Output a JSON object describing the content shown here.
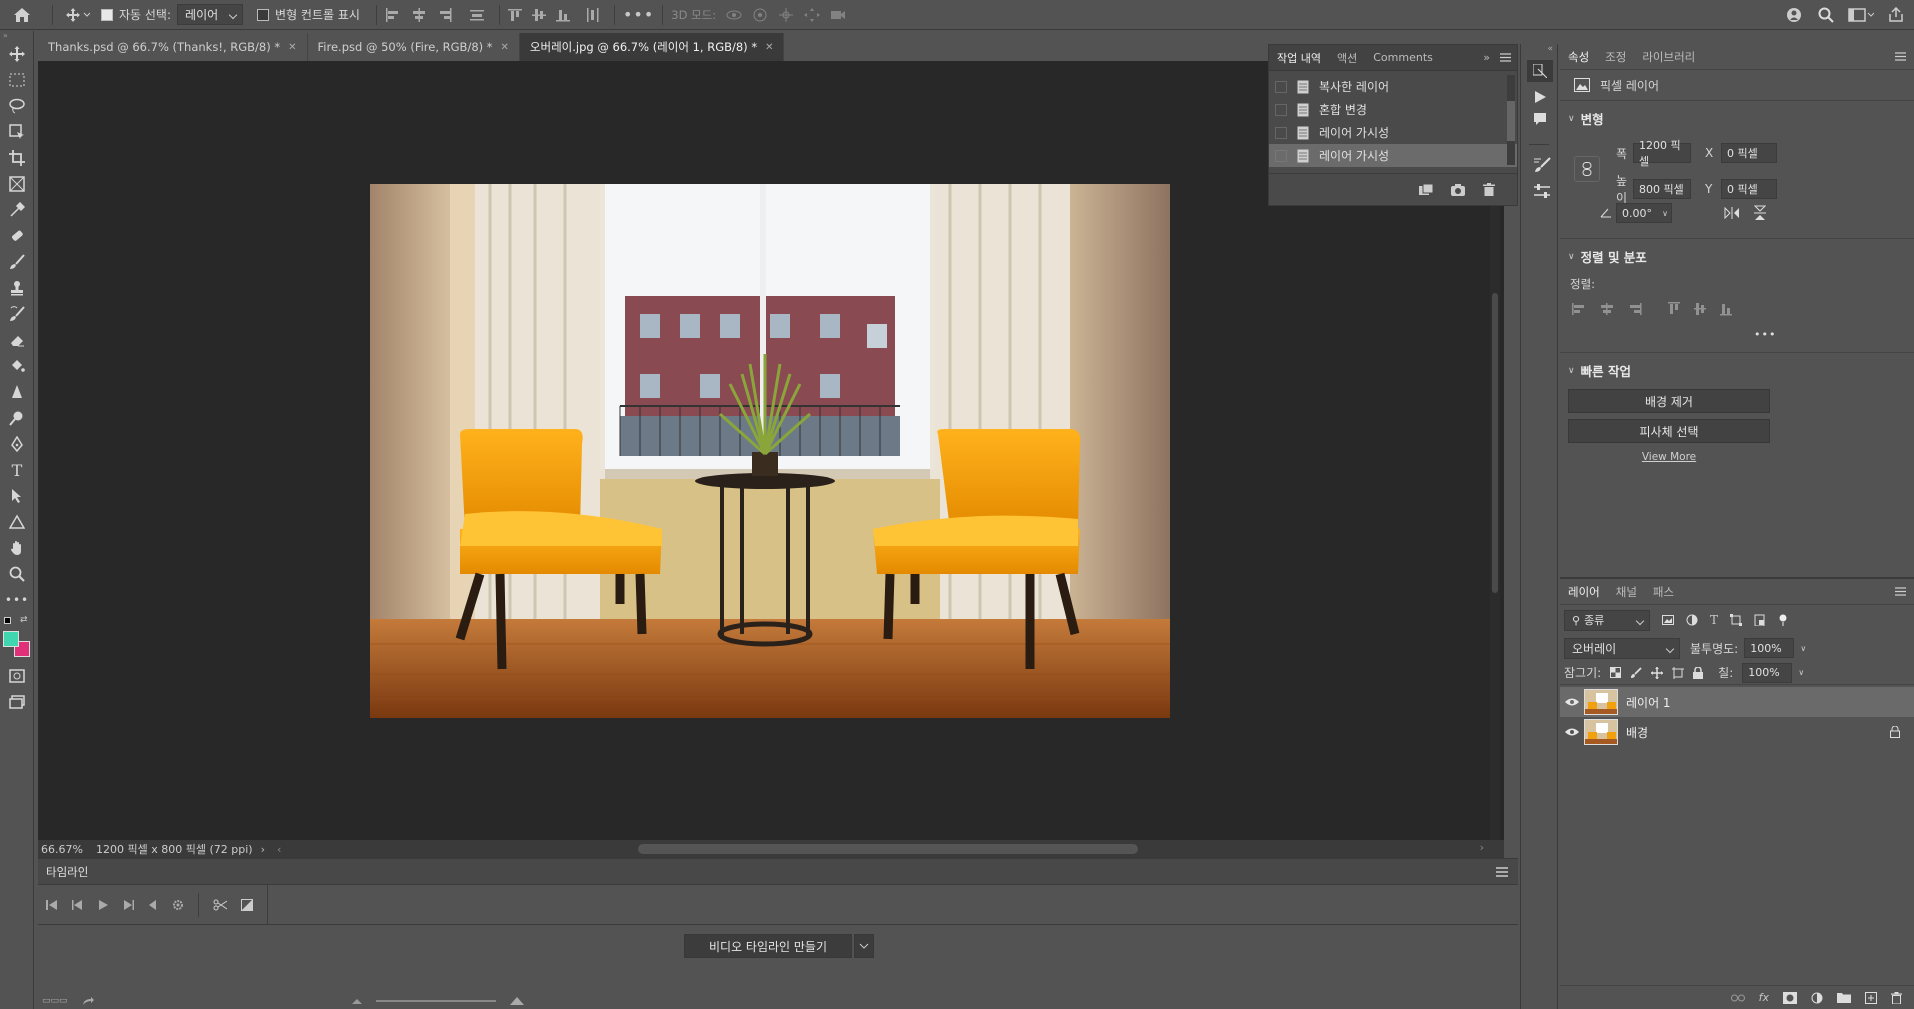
{
  "options_bar": {
    "auto_select_label": "자동 선택:",
    "auto_select_value": "레이어",
    "transform_controls_label": "변형 컨트롤 표시",
    "mode_3d_label": "3D 모드:"
  },
  "tabs": [
    {
      "label": "Thanks.psd @ 66.7% (Thanks!, RGB/8) *"
    },
    {
      "label": "Fire.psd @ 50% (Fire, RGB/8) *"
    },
    {
      "label": "오버레이.jpg @ 66.7% (레이어 1, RGB/8) *"
    }
  ],
  "status": {
    "zoom": "66.67%",
    "doc_info": "1200 픽셀 x 800 픽셀 (72 ppi)"
  },
  "timeline": {
    "title": "타임라인",
    "create_button": "비디오 타임라인 만들기"
  },
  "history": {
    "tabs": [
      "작업 내역",
      "액션",
      "Comments"
    ],
    "items": [
      {
        "label": "복사한 레이어"
      },
      {
        "label": "혼합 변경"
      },
      {
        "label": "레이어 가시성"
      },
      {
        "label": "레이어 가시성"
      }
    ]
  },
  "properties": {
    "tabs": [
      "속성",
      "조정",
      "라이브러리"
    ],
    "type_label": "픽셀 레이어",
    "transform": {
      "title": "변형",
      "width_label": "폭",
      "width_value": "1200 픽셀",
      "height_label": "높이",
      "height_value": "800 픽셀",
      "x_label": "X",
      "x_value": "0 픽셀",
      "y_label": "Y",
      "y_value": "0 픽셀",
      "angle_value": "0.00°"
    },
    "align": {
      "title": "정렬 및 분포",
      "label": "정렬:"
    },
    "quick": {
      "title": "빠른 작업",
      "remove_bg": "배경 제거",
      "select_subject": "피사체 선택",
      "view_more": "View More"
    }
  },
  "layers": {
    "tabs": [
      "레이어",
      "채널",
      "패스"
    ],
    "filter_value": "종류",
    "blend_mode": "오버레이",
    "opacity_label": "불투명도:",
    "opacity_value": "100%",
    "lock_label": "잠그기:",
    "fill_label": "칠:",
    "fill_value": "100%",
    "items": [
      {
        "name": "레이어 1"
      },
      {
        "name": "배경"
      }
    ]
  },
  "colors": {
    "foreground": "#3fd6b0",
    "background": "#e0307a"
  }
}
